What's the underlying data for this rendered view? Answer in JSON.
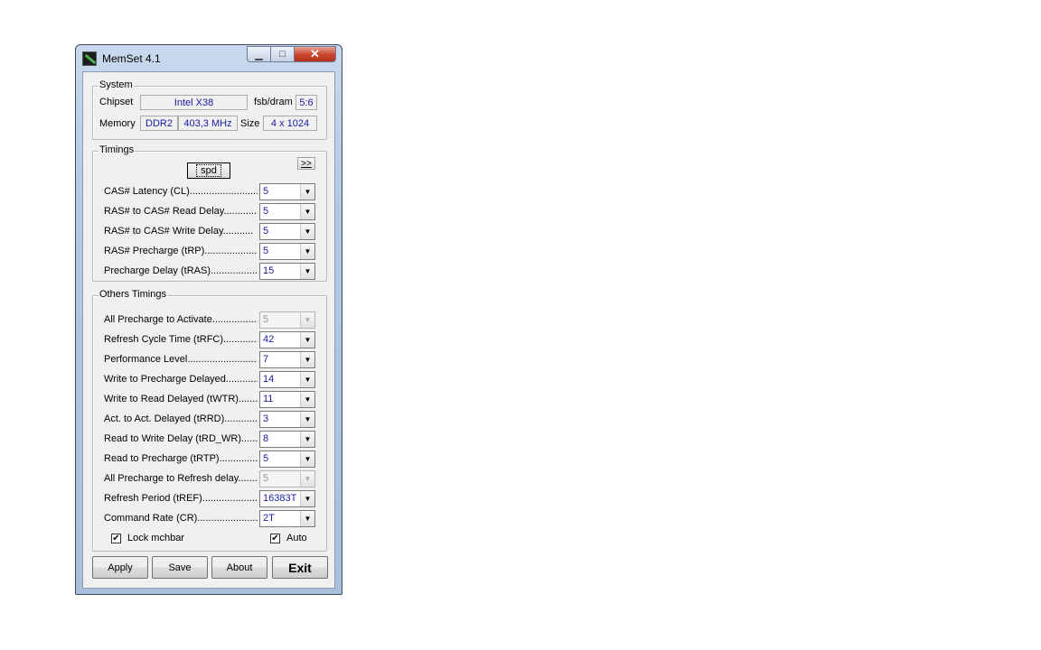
{
  "window": {
    "title": "MemSet 4.1",
    "caption": {
      "minimize": "▁",
      "maximize": "□",
      "close": "✕"
    }
  },
  "system": {
    "group_label": "System",
    "chipset_label": "Chipset",
    "chipset_value": "Intel  X38",
    "fsb_label": "fsb/dram",
    "fsb_value": "5:6",
    "memory_label": "Memory",
    "memory_type": "DDR2",
    "memory_freq": "403,3 MHz",
    "size_label": "Size",
    "size_value": "4 x 1024"
  },
  "timings": {
    "group_label": "Timings",
    "spd_button": "spd",
    "more_button": ">>",
    "rows": [
      {
        "label": "CAS# Latency (CL)..........................",
        "value": "5",
        "enabled": true
      },
      {
        "label": "RAS# to CAS# Read Delay............",
        "value": "5",
        "enabled": true
      },
      {
        "label": "RAS# to CAS# Write Delay...........",
        "value": "5",
        "enabled": true
      },
      {
        "label": "RAS# Precharge (tRP)....................",
        "value": "5",
        "enabled": true
      },
      {
        "label": "Precharge Delay  (tRAS)..................",
        "value": "15",
        "enabled": true
      }
    ]
  },
  "others": {
    "group_label": "Others Timings",
    "rows": [
      {
        "label": "All Precharge to Activate..................",
        "value": "5",
        "enabled": false
      },
      {
        "label": "Refresh Cycle Time (tRFC)..............",
        "value": "42",
        "enabled": true
      },
      {
        "label": "Performance Level...........................",
        "value": "7",
        "enabled": true
      },
      {
        "label": "Write to Precharge Delayed.............",
        "value": "14",
        "enabled": true
      },
      {
        "label": "Write to Read Delayed (tWTR).........",
        "value": "11",
        "enabled": true
      },
      {
        "label": "Act. to Act. Delayed (tRRD).............",
        "value": "3",
        "enabled": true
      },
      {
        "label": "Read to Write Delay (tRD_WR).......",
        "value": "8",
        "enabled": true
      },
      {
        "label": "Read to Precharge (tRTP)...............",
        "value": "5",
        "enabled": true
      },
      {
        "label": "All Precharge to Refresh delay........",
        "value": "5",
        "enabled": false
      },
      {
        "label": "Refresh Period (tREF)......................",
        "value": "16383T",
        "enabled": true
      },
      {
        "label": "Command Rate (CR)........................",
        "value": "2T",
        "enabled": true
      }
    ],
    "lock_label": "Lock mchbar",
    "lock_checked": true,
    "auto_label": "Auto",
    "auto_checked": true
  },
  "buttons": {
    "apply": "Apply",
    "save": "Save",
    "about": "About",
    "exit": "Exit"
  },
  "check_glyph": "✔",
  "arrow_glyph": "▼"
}
